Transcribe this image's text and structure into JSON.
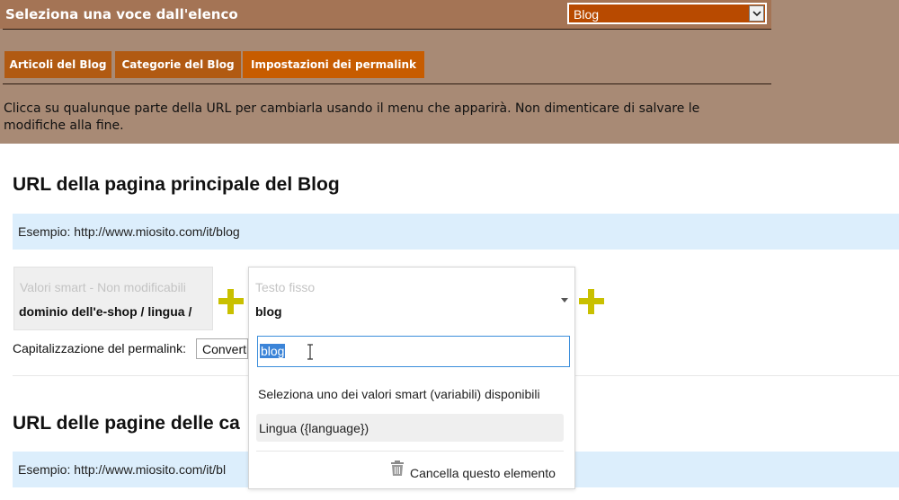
{
  "header": {
    "title": "Seleziona una voce dall'elenco",
    "select_value": "Blog"
  },
  "tabs": [
    {
      "label": "Articoli del Blog"
    },
    {
      "label": "Categorie del Blog"
    },
    {
      "label": "Impostazioni dei permalink"
    }
  ],
  "help_text": "Clicca su qualunque parte della URL per cambiarla usando il menu che apparirà. Non dimenticare di salvare le modifiche alla fine.",
  "section1": {
    "title": "URL della pagina principale del Blog",
    "example": "Esempio: http://www.miosito.com/it/blog",
    "smart_label": "Valori smart - Non modificabili",
    "smart_value": "dominio dell'e-shop / lingua /",
    "fixed_label": "Testo fisso",
    "fixed_value": "blog",
    "capitalization_label": "Capitalizzazione del permalink:",
    "capitalization_value": "Converti"
  },
  "dropdown": {
    "input_value": "blog",
    "caption": "Seleziona uno dei valori smart (variabili) disponibili",
    "option": "Lingua ({language})",
    "delete_label": "Cancella questo elemento"
  },
  "section2": {
    "title": "URL delle pagine delle ca",
    "example": "Esempio: http://www.miosito.com/it/bl"
  },
  "colors": {
    "header_brown": "#a47455",
    "area_brown": "#a88a75",
    "tab_orange": "#b15a12",
    "select_orange": "#b84a00",
    "example_blue": "#dceefc",
    "plus_yellow": "#c9c000",
    "selection_blue": "#3b84d8"
  }
}
